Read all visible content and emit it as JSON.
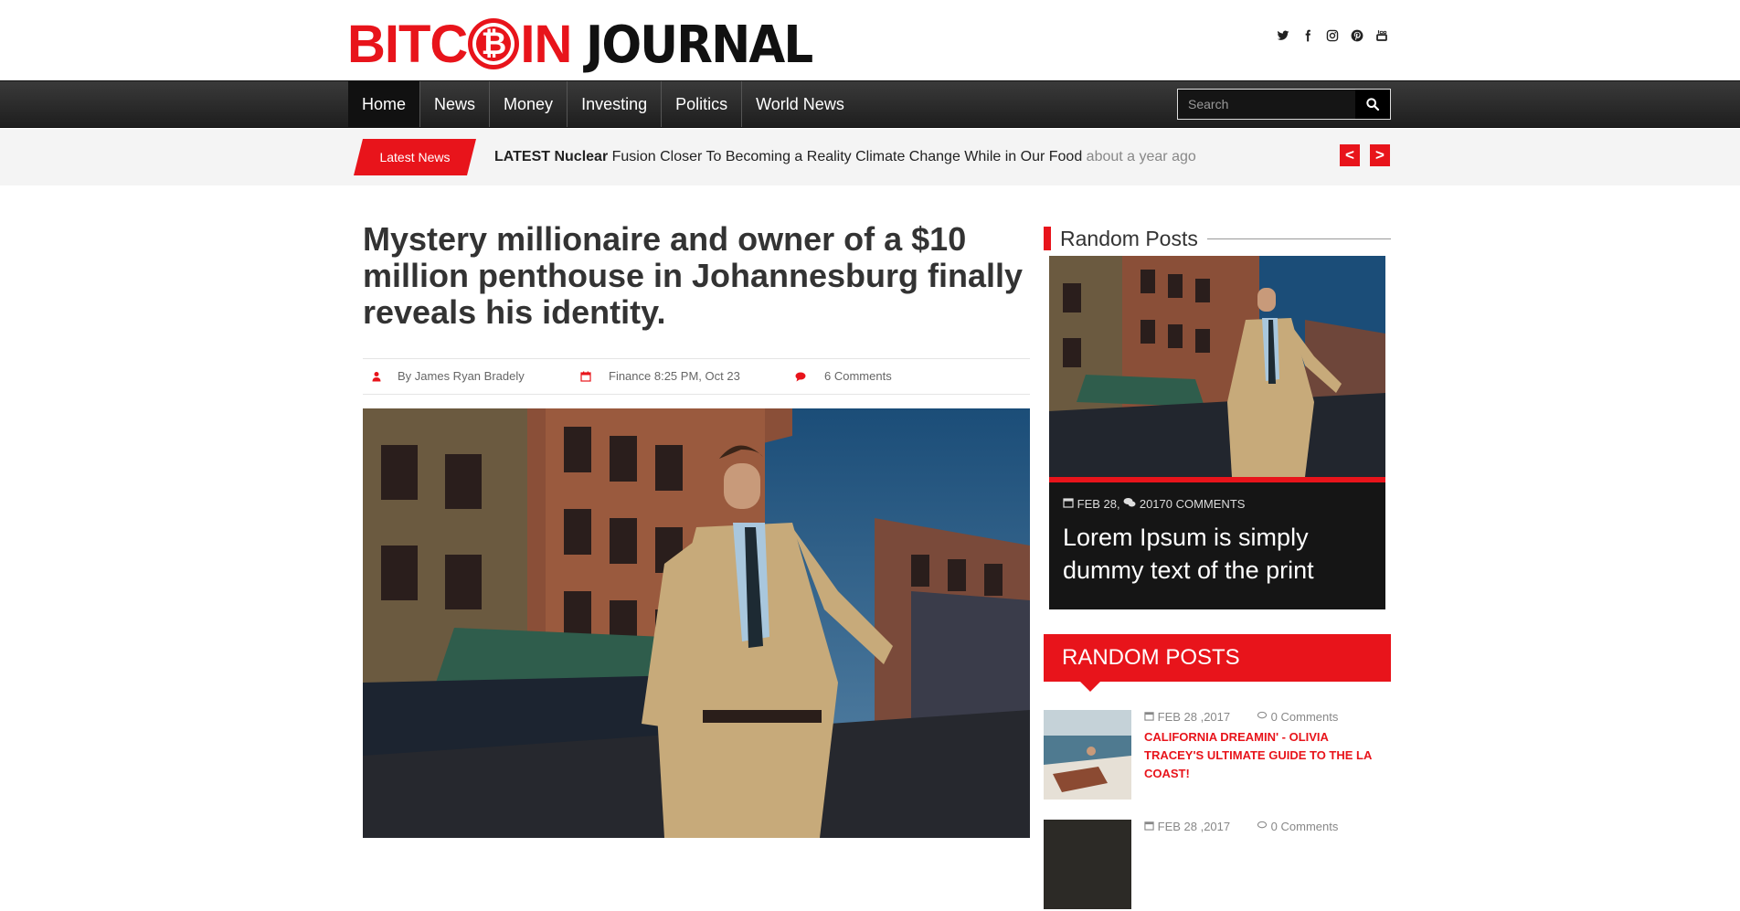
{
  "brand": {
    "part1": "BITC",
    "coin_symbol": "₿",
    "part2": "IN",
    "part3": "JOURNAL"
  },
  "social_icons": [
    "twitter-icon",
    "facebook-icon",
    "instagram-icon",
    "pinterest-icon",
    "youtube-icon"
  ],
  "nav": {
    "items": [
      {
        "label": "Home",
        "active": true
      },
      {
        "label": "News"
      },
      {
        "label": "Money"
      },
      {
        "label": "Investing"
      },
      {
        "label": "Politics"
      },
      {
        "label": "World News"
      }
    ],
    "search_placeholder": "Search"
  },
  "ticker": {
    "badge": "Latest News",
    "bold": "LATEST Nuclear",
    "text": " Fusion Closer To Becoming a Reality Climate Change While in Our Food ",
    "ago": "about a year ago",
    "prev": "<",
    "next": ">"
  },
  "article": {
    "title": "Mystery millionaire and owner of a $10 million penthouse in Johannesburg finally reveals his identity.",
    "author": "By James Ryan Bradely",
    "category_date": "Finance 8:25 PM, Oct 23",
    "comments": "6 Comments"
  },
  "sidebar": {
    "random_posts_title": "Random Posts",
    "feature": {
      "date": "FEB 28,",
      "comments": "20170 COMMENTS",
      "title": "Lorem Ipsum is simply dummy text of the print"
    },
    "random_posts_header": "RANDOM POSTS",
    "posts": [
      {
        "date": "FEB 28 ,2017",
        "comments": "0 Comments",
        "title": "CALIFORNIA DREAMIN' - OLIVIA TRACEY'S ULTIMATE GUIDE TO THE LA COAST!"
      },
      {
        "date": "FEB 28 ,2017",
        "comments": "0 Comments",
        "title": ""
      }
    ]
  },
  "colors": {
    "accent": "#e8141b",
    "nav_bg": "#2a2a2a",
    "text_dark": "#333333"
  }
}
